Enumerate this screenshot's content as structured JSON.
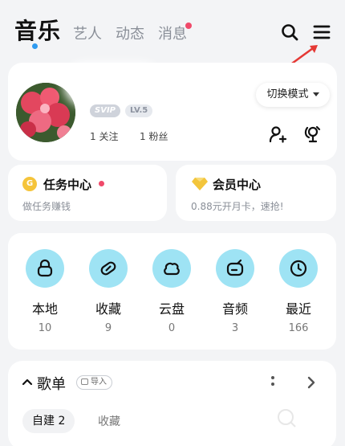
{
  "topnav": {
    "tabs": [
      "音乐",
      "艺人",
      "动态",
      "消息"
    ],
    "active_index": 0,
    "search_icon": "search-icon",
    "menu_icon": "menu-icon"
  },
  "profile": {
    "badges": {
      "svip": "SVIP",
      "level": "LV.5"
    },
    "following_label": "1 关注",
    "fans_label": "1 粉丝",
    "switch_mode_label": "切换模式",
    "add_friend_icon": "add-user-icon",
    "identify_icon": "music-recognize-icon"
  },
  "tasks": {
    "task_title": "任务中心",
    "task_subtitle": "做任务赚钱",
    "vip_title": "会员中心",
    "vip_subtitle": "0.88元开月卡，速抢!"
  },
  "shortcuts": [
    {
      "label": "本地",
      "count": "10",
      "icon": "local-music-icon"
    },
    {
      "label": "收藏",
      "count": "9",
      "icon": "heart-icon"
    },
    {
      "label": "云盘",
      "count": "0",
      "icon": "cloud-icon"
    },
    {
      "label": "音频",
      "count": "3",
      "icon": "radio-icon"
    },
    {
      "label": "最近",
      "count": "166",
      "icon": "clock-icon"
    }
  ],
  "playlists": {
    "title": "歌单",
    "import_label": "导入",
    "tabs": [
      "自建 2",
      "收藏"
    ]
  },
  "colors": {
    "accent_blue": "#2f9bf0",
    "notify_red": "#f04a6a",
    "icon_bg": "#9ee3f4"
  }
}
